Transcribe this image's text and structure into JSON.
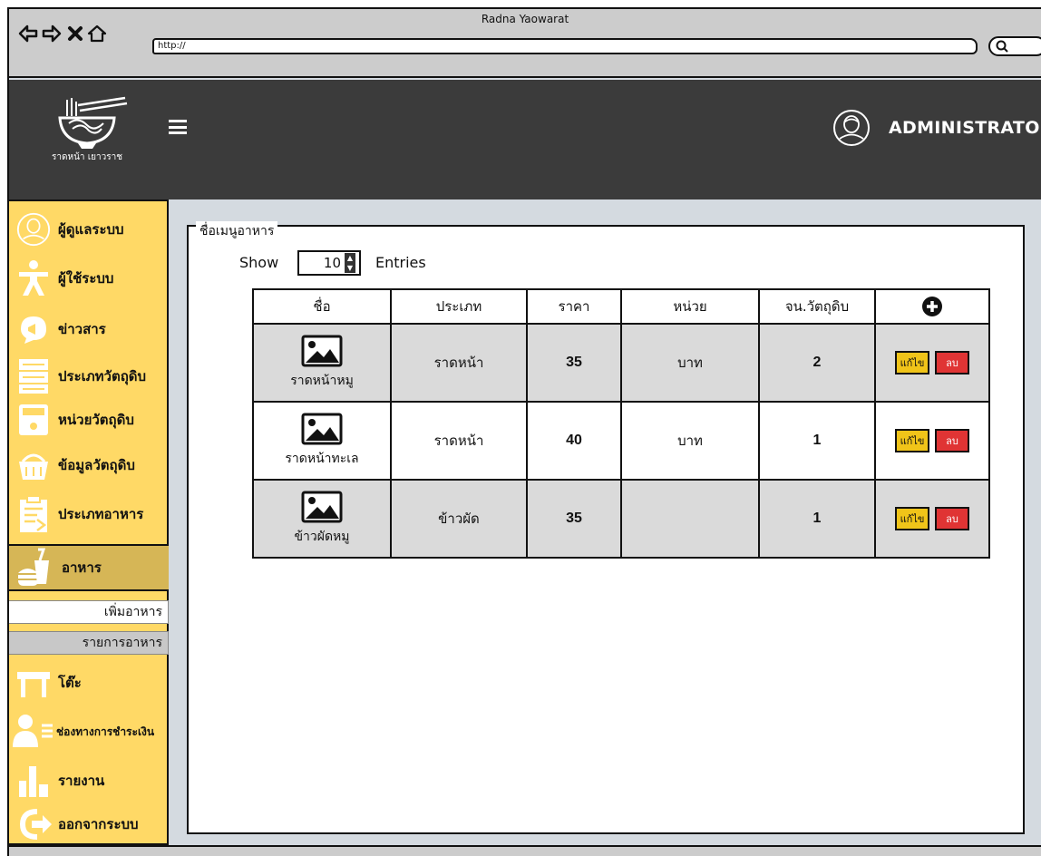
{
  "browser": {
    "title": "Radna Yaowarat",
    "url": "http://"
  },
  "header": {
    "logo_text": "ราดหน้า เยาวราช",
    "admin_name": "ADMINISTRATOR"
  },
  "sidebar": {
    "items": [
      {
        "label": "ผู้ดูแลระบบ",
        "icon": "admin-avatar-icon"
      },
      {
        "label": "ผู้ใช้ระบบ",
        "icon": "person-icon"
      },
      {
        "label": "ข่าวสาร",
        "icon": "megaphone-icon"
      },
      {
        "label": "ประเภทวัตถุดิบ",
        "icon": "server-icon"
      },
      {
        "label": "หน่วยวัตถุดิบ",
        "icon": "scale-icon"
      },
      {
        "label": "ข้อมูลวัตถุดิบ",
        "icon": "basket-icon"
      },
      {
        "label": "ประเภทอาหาร",
        "icon": "clipboard-icon"
      },
      {
        "label": "อาหาร",
        "icon": "fastfood-icon",
        "active": true
      },
      {
        "label": "โต๊ะ",
        "icon": "table-icon"
      },
      {
        "label": "ช่องทางการชำระเงิน",
        "icon": "user-card-icon"
      },
      {
        "label": "รายงาน",
        "icon": "bar-chart-icon"
      },
      {
        "label": "ออกจากระบบ",
        "icon": "logout-icon"
      }
    ],
    "sub_items": [
      {
        "label": "เพิ่มอาหาร"
      },
      {
        "label": "รายการอาหาร"
      }
    ]
  },
  "panel": {
    "legend": "ชื่อเมนูอาหาร",
    "show_label": "Show",
    "entries_value": "10",
    "entries_label": "Entries"
  },
  "table": {
    "headers": [
      "ชื่อ",
      "ประเภท",
      "ราคา",
      "หน่วย",
      "จน.วัตถุดิบ"
    ],
    "add_icon": "plus-circle-icon",
    "rows": [
      {
        "name": "ราดหน้าหมู",
        "type": "ราดหน้า",
        "price": "35",
        "unit": "บาท",
        "qty": "2"
      },
      {
        "name": "ราดหน้าทะเล",
        "type": "ราดหน้า",
        "price": "40",
        "unit": "บาท",
        "qty": "1"
      },
      {
        "name": "ข้าวผัดหมู",
        "type": "ข้าวผัด",
        "price": "35",
        "unit": "",
        "qty": "1"
      }
    ],
    "edit_label": "แก้ไข",
    "delete_label": "ลบ"
  },
  "colors": {
    "sidebar_bg": "#ffd966",
    "sidebar_active": "#d6b656",
    "header_bg": "#3b3b3b",
    "edit_btn": "#f0c419",
    "delete_btn": "#e03434"
  }
}
